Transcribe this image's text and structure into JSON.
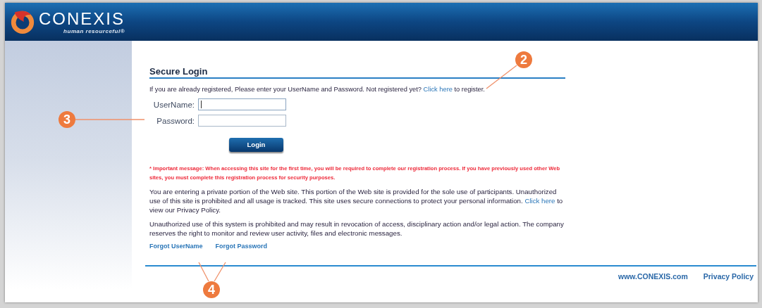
{
  "logo": {
    "name": "CONEXIS",
    "tagline": "human resourceful®"
  },
  "login": {
    "title": "Secure Login",
    "intro": {
      "before": "If you are already registered, Please enter your UserName and Password. Not registered yet?",
      "link": "Click here",
      "after": "to register."
    },
    "fields": [
      {
        "label": "UserName:",
        "focused": true
      },
      {
        "label": "Password:",
        "focused": false
      }
    ],
    "button": "Login",
    "important": "* Important message: When accessing this site for the first time, you will be required to complete our registration process. If you have previously used other Web sites, you must complete this registration process for security purposes.",
    "notice": {
      "before": "You are entering a private portion of the Web site. This portion of the Web site is provided for the sole use of participants. Unauthorized use of this site is prohibited and all usage is tracked. This site uses secure connections to protect your personal information.",
      "link": "Click here",
      "after": "to view our Privacy Policy."
    },
    "warning": "Unauthorized use of this system is prohibited and may result in revocation of access, disciplinary action and/or legal action. The company reserves the right to monitor and review user activity, files and electronic messages.",
    "links": [
      "Forgot UserName",
      "Forgot Password"
    ]
  },
  "footer": {
    "links": [
      "www.CONEXIS.com",
      "Privacy Policy"
    ]
  },
  "callouts": [
    {
      "label": "2"
    },
    {
      "label": "3"
    },
    {
      "label": "4"
    }
  ]
}
